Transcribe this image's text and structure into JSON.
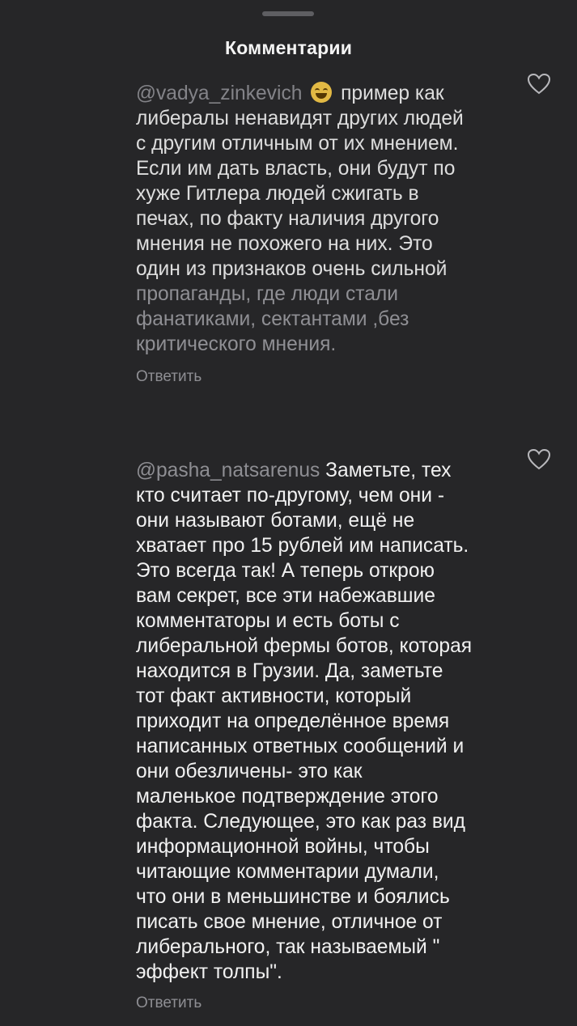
{
  "sheet": {
    "title": "Комментарии"
  },
  "comments": [
    {
      "mention": "@vadya_zinkevich",
      "emoji": "grinning-sweat-emoji",
      "text_bright": " пример как\nлибералы ненавидят других людей\nс другим отличным от их мнением.\nЕсли им дать власть, они будут по\nхуже Гитлера людей сжигать в\nпечах, по факту наличия другого\nмнения не похожего на них. Это\nодин из признаков очень сильной\n",
      "text_faded": "пропаганды, где люди стали\nфанатиками, сектантами ,без\nкритического мнения.",
      "reply_label": "Ответить"
    },
    {
      "mention": "@pasha_natsarenus",
      "text": " Заметьте, тех\nкто считает по-другому, чем они -\nони называют ботами, ещё не\nхватает про 15 рублей им написать.\nЭто всегда так! А теперь открою\nвам секрет, все эти набежавшие\nкомментаторы и есть боты с\nлиберальной фермы ботов, которая\nнаходится в Грузии. Да, заметьте\nтот факт активности, который\nприходит на определённое время\nнаписанных ответных сообщений и\nони обезличены- это как\nмаленькое подтверждение этого\nфакта. Следующее, это как раз вид\nинформационной войны, чтобы\nчитающие комментарии думали,\nчто они в меньшинстве и боялись\nписать свое мнение, отличное от\nлиберального, так называемый \"\nэффект толпы\".",
      "reply_label": "Ответить"
    }
  ],
  "icons": {
    "like": "heart-outline-icon"
  },
  "colors": {
    "background": "#262628",
    "text": "#f1f1f1",
    "muted": "#8e8e93",
    "handle": "#5e5e62"
  }
}
